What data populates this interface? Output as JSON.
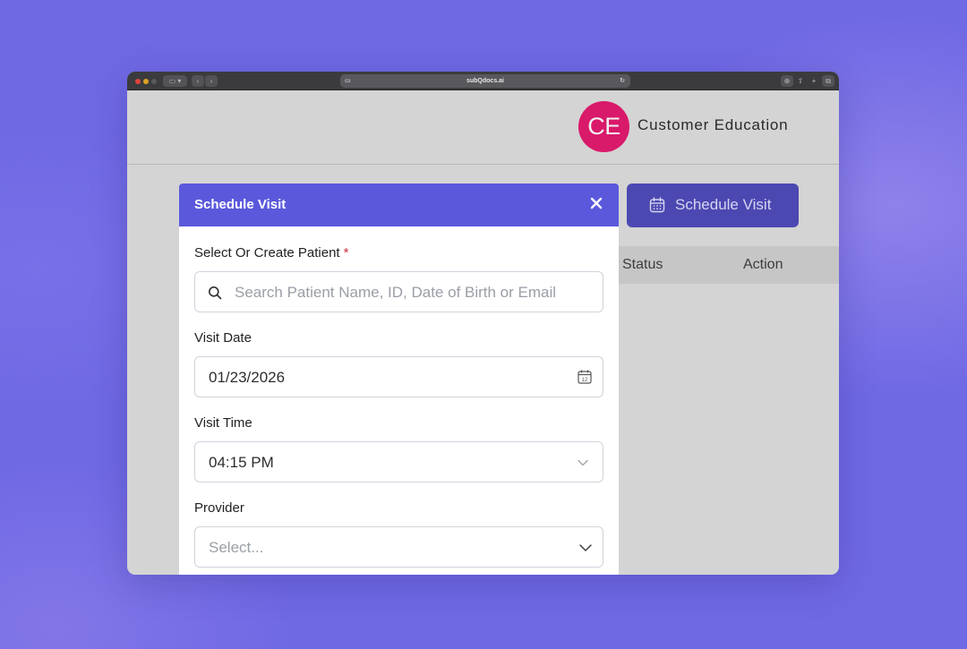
{
  "browser": {
    "url": "subQdocs.ai"
  },
  "header": {
    "logo_initials": "CE",
    "logo_text": "Customer Education",
    "logo_color": "#d9196a"
  },
  "background": {
    "schedule_button_label": "Schedule Visit",
    "table_columns": [
      "Status",
      "Action"
    ]
  },
  "modal": {
    "title": "Schedule Visit",
    "accent_color": "#5b58dc",
    "patient": {
      "label": "Select Or Create Patient",
      "required_mark": "*",
      "placeholder": "Search Patient Name, ID, Date of Birth or Email"
    },
    "visit_date": {
      "label": "Visit Date",
      "value": "01/23/2026"
    },
    "visit_time": {
      "label": "Visit Time",
      "value": "04:15 PM"
    },
    "provider": {
      "label": "Provider",
      "placeholder": "Select..."
    }
  }
}
